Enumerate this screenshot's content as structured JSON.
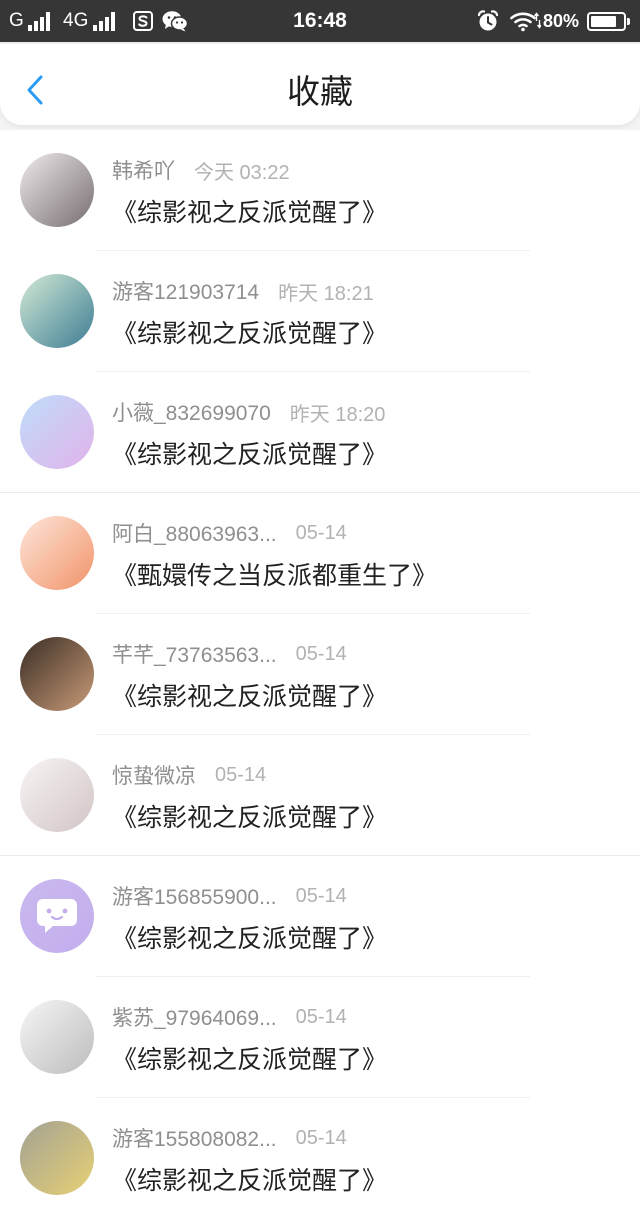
{
  "status_bar": {
    "network1": "G",
    "network2": "4G",
    "time": "16:48",
    "battery": "80%",
    "icons": {
      "signal": "signal-icon",
      "app": "s-app-icon",
      "wechat": "wechat-icon",
      "alarm": "alarm-icon",
      "wifi": "wifi-icon",
      "battery": "battery-icon"
    }
  },
  "header": {
    "title": "收藏",
    "back_icon": "chevron-left-icon",
    "accent_color": "#2b9cf3"
  },
  "favorites": [
    {
      "user": "韩希吖",
      "time": "今天 03:22",
      "book": "《综影视之反派觉醒了》",
      "avatar": {
        "icon": "user-avatar",
        "colors": [
          "#efeaec",
          "#766d71"
        ]
      }
    },
    {
      "user": "游客121903714",
      "time": "昨天 18:21",
      "book": "《综影视之反派觉醒了》",
      "avatar": {
        "icon": "user-avatar",
        "colors": [
          "#d3e9d5",
          "#3d7d93"
        ]
      }
    },
    {
      "user": "小薇_832699070",
      "time": "昨天 18:20",
      "book": "《综影视之反派觉醒了》",
      "avatar": {
        "icon": "user-avatar",
        "colors": [
          "#bfddfa",
          "#e2b2ea"
        ]
      }
    },
    {
      "user": "阿白_88063963...",
      "time": "05-14",
      "book": "《甄嬛传之当反派都重生了》",
      "avatar": {
        "icon": "user-avatar",
        "colors": [
          "#fde6da",
          "#f2936a"
        ]
      }
    },
    {
      "user": "芊芊_73763563...",
      "time": "05-14",
      "book": "《综影视之反派觉醒了》",
      "avatar": {
        "icon": "user-avatar",
        "colors": [
          "#3a2d25",
          "#c99b78"
        ]
      }
    },
    {
      "user": "惊蛰微凉",
      "time": "05-14",
      "book": "《综影视之反派觉醒了》",
      "avatar": {
        "icon": "user-avatar",
        "colors": [
          "#f8f5f5",
          "#d2c4c4"
        ]
      }
    },
    {
      "user": "游客156855900...",
      "time": "05-14",
      "book": "《综影视之反派觉醒了》",
      "avatar": {
        "icon": "chat-bubble-icon",
        "colors": [
          "#cab8ef",
          "#c3aeec"
        ]
      }
    },
    {
      "user": "紫苏_97964069...",
      "time": "05-14",
      "book": "《综影视之反派觉醒了》",
      "avatar": {
        "icon": "user-avatar",
        "colors": [
          "#f6f6f6",
          "#bcbcbc"
        ]
      }
    },
    {
      "user": "游客155808082...",
      "time": "05-14",
      "book": "《综影视之反派觉醒了》",
      "avatar": {
        "icon": "user-avatar",
        "colors": [
          "#a3a294",
          "#e7d074"
        ]
      }
    }
  ]
}
